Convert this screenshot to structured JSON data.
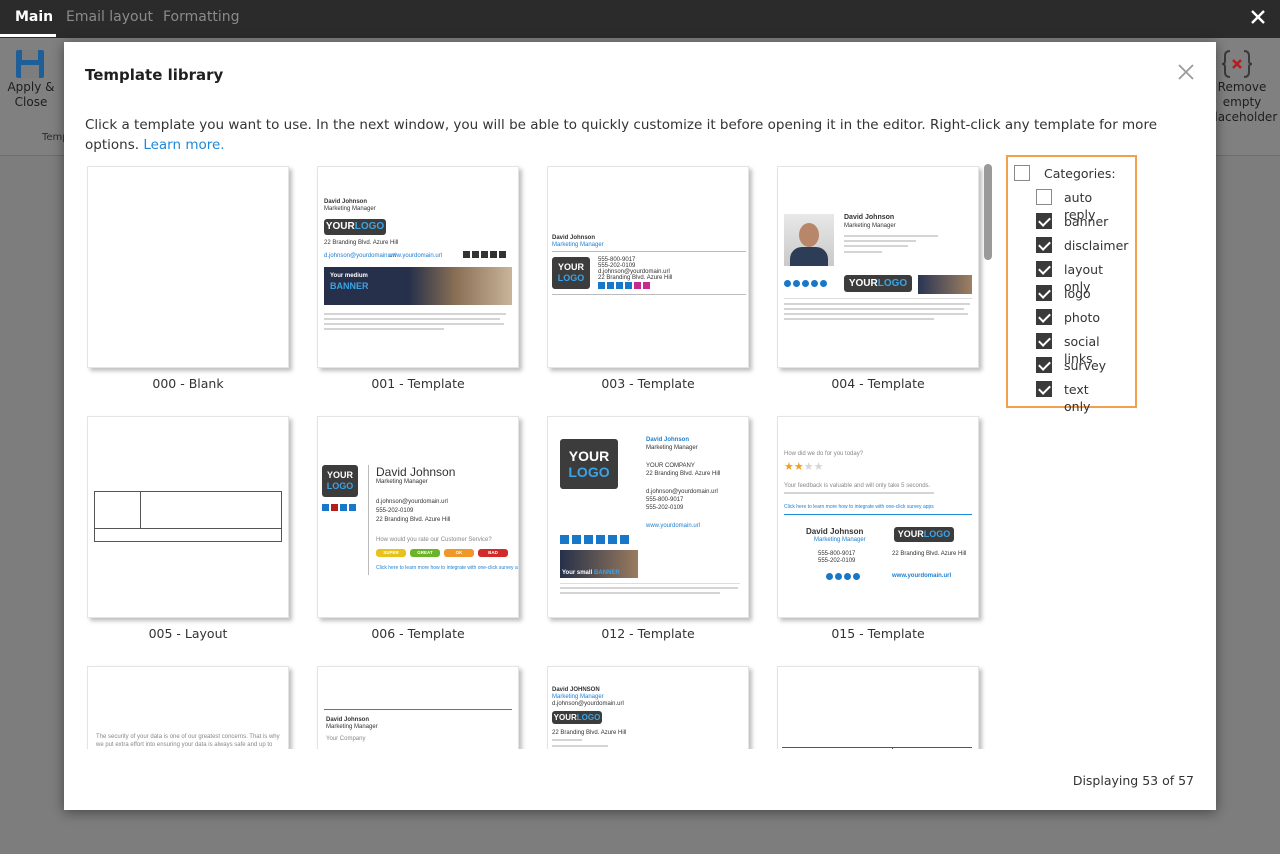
{
  "app": {
    "tabs": [
      {
        "label": "Main",
        "active": true
      },
      {
        "label": "Email layout",
        "active": false
      },
      {
        "label": "Formatting",
        "active": false
      }
    ],
    "ribbon": {
      "apply_close": "Apply &\nClose",
      "group_label": "Temp",
      "remove_placeholder": "Remove\nempty\nplaceholder"
    }
  },
  "modal": {
    "title": "Template library",
    "intro_text": "Click a template you want to use. In the next window, you will be able to quickly customize it before opening it in the editor. Right-click any template for more options.",
    "learn_more": "Learn more.",
    "status": "Displaying 53 of 57"
  },
  "templates": [
    {
      "label": "000 - Blank"
    },
    {
      "label": "001 - Template"
    },
    {
      "label": "003 - Template"
    },
    {
      "label": "004 - Template"
    },
    {
      "label": "005 - Layout"
    },
    {
      "label": "006 - Template"
    },
    {
      "label": "012 - Template"
    },
    {
      "label": "015 - Template"
    }
  ],
  "thumbs": {
    "name": "David Johnson",
    "name_upper": "David JOHNSON",
    "role": "Marketing Manager",
    "logo_your": "YOUR",
    "logo_logo": "LOGO",
    "banner_medium": "Your medium",
    "banner_word": "BANNER",
    "banner_small": "Your small",
    "company_upper": "YOUR COMPANY",
    "company": "Your Company",
    "address": "22 Branding Blvd. Azure Hill",
    "email": "d.johnson@yourdomain.url",
    "website": "www.yourdomain.url",
    "phone": "555-800-9017",
    "mobile": "555-202-0109",
    "survey_q": "How did we do for you today?",
    "feedback": "Your feedback is valuable and will only take 5 seconds.",
    "survey_link": "Click here to learn more how to integrate with one-click survey apps",
    "rate_q": "How would you rate our Customer Service?",
    "rate_super": "SUPER",
    "rate_great": "GREAT",
    "rate_ok": "OK",
    "rate_bad": "BAD",
    "privacy": "The security of your data is one of our greatest concerns. That is why we put extra effort into ensuring your data is always safe and up to date."
  },
  "categories": {
    "header": "Categories:",
    "header_checked": false,
    "items": [
      {
        "label": "auto reply",
        "checked": false
      },
      {
        "label": "banner",
        "checked": true
      },
      {
        "label": "disclaimer",
        "checked": true
      },
      {
        "label": "layout only",
        "checked": true
      },
      {
        "label": "logo",
        "checked": true
      },
      {
        "label": "photo",
        "checked": true
      },
      {
        "label": "social links",
        "checked": true
      },
      {
        "label": "survey",
        "checked": true
      },
      {
        "label": "text only",
        "checked": true
      }
    ]
  },
  "colors": {
    "accent_blue": "#1e88d8",
    "highlight_orange": "#f3a04d",
    "topbar": "#2b2b2b",
    "checkbox_on": "#3a3a3a"
  }
}
